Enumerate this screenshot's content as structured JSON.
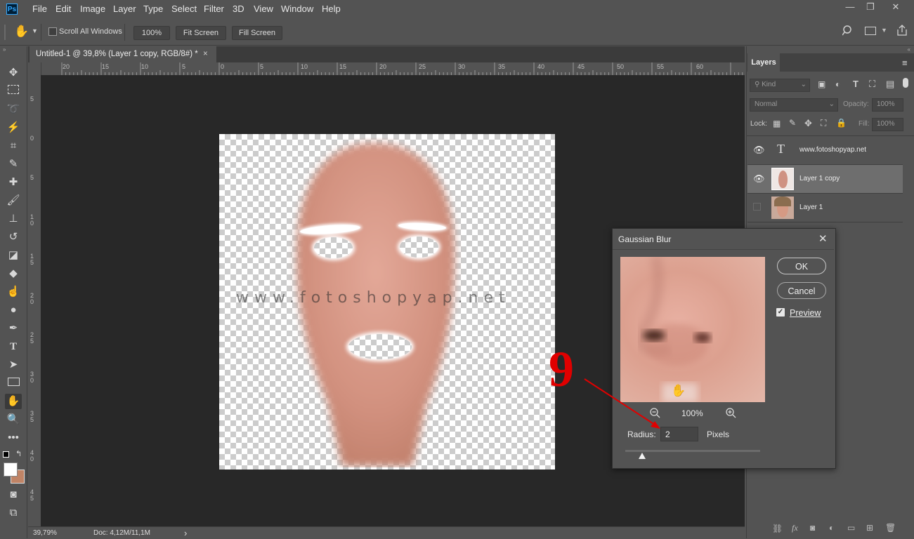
{
  "app": {
    "logo": "Ps"
  },
  "menu": [
    "File",
    "Edit",
    "Image",
    "Layer",
    "Type",
    "Select",
    "Filter",
    "3D",
    "View",
    "Window",
    "Help"
  ],
  "window_controls": {
    "minimize": "—",
    "restore": "❐",
    "close": "✕"
  },
  "options_bar": {
    "tool_icon": "hand-icon",
    "scroll_all_windows_label": "Scroll All Windows",
    "zoom_100_label": "100%",
    "fit_screen_label": "Fit Screen",
    "fill_screen_label": "Fill Screen"
  },
  "document_tab": {
    "title": "Untitled-1 @ 39,8% (Layer 1 copy, RGB/8#) *",
    "close": "×"
  },
  "ruler_top_labels": [
    "20",
    "15",
    "10",
    "5",
    "0",
    "5",
    "10",
    "15",
    "20",
    "25",
    "30",
    "35",
    "40",
    "45",
    "50",
    "55",
    "60"
  ],
  "ruler_left_labels": [
    "5",
    "0",
    "5",
    "1\n0",
    "1\n5",
    "2\n0",
    "2\n5",
    "3\n0",
    "3\n5",
    "4\n0",
    "4\n5"
  ],
  "canvas": {
    "watermark": "www.fotoshopyap.net"
  },
  "status_bar": {
    "zoom": "39,79%",
    "doc": "Doc: 4,12M/11,1M",
    "arrow": "›"
  },
  "layers_panel": {
    "tab_label": "Layers",
    "filter_kind": "Kind",
    "blend_mode": "Normal",
    "opacity_label": "Opacity:",
    "opacity_value": "100%",
    "lock_label": "Lock:",
    "fill_label": "Fill:",
    "fill_value": "100%",
    "layers": [
      {
        "name": "www.fotoshopyap.net",
        "visible": true,
        "type": "text"
      },
      {
        "name": "Layer 1 copy",
        "visible": true,
        "type": "image",
        "selected": true
      },
      {
        "name": "Layer 1",
        "visible": false,
        "type": "image"
      }
    ]
  },
  "gaussian_blur_dialog": {
    "title": "Gaussian Blur",
    "ok_label": "OK",
    "cancel_label": "Cancel",
    "preview_label": "Preview",
    "preview_checked": true,
    "zoom_value": "100%",
    "radius_label": "Radius:",
    "radius_value": "2",
    "unit_label": "Pixels",
    "slider_value": 2
  },
  "annotation": {
    "step_number": "9",
    "color": "#e00000"
  }
}
